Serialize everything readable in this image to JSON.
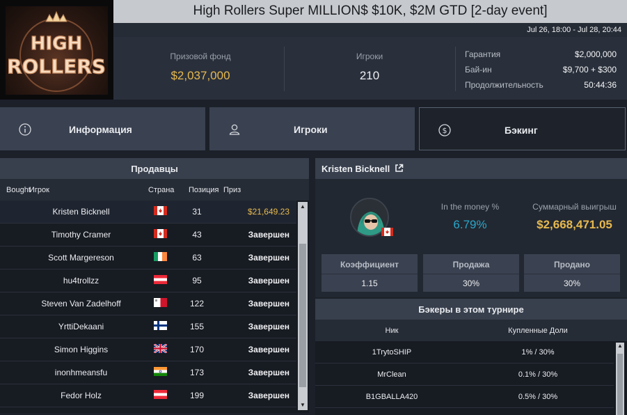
{
  "header": {
    "logo_text": "HIGH ROLLERS",
    "title": "High Rollers Super MILLION$ $10K, $2M GTD [2-day event]",
    "dates": "Jul 26, 18:00 - Jul 28, 20:44"
  },
  "stats": {
    "prize_pool_label": "Призовой фонд",
    "prize_pool_value": "$2,037,000",
    "players_label": "Игроки",
    "players_value": "210",
    "details": [
      {
        "label": "Гарантия",
        "value": "$2,000,000"
      },
      {
        "label": "Бай-ин",
        "value": "$9,700 + $300"
      },
      {
        "label": "Продолжительность",
        "value": "50:44:36"
      }
    ]
  },
  "tabs": [
    {
      "label": "Информация",
      "icon": "info-circle-icon",
      "active": false
    },
    {
      "label": "Игроки",
      "icon": "user-icon",
      "active": false
    },
    {
      "label": "Бэкинг",
      "icon": "dollar-circle-icon",
      "active": true
    }
  ],
  "sellers": {
    "title": "Продавцы",
    "columns": {
      "bought": "Bought",
      "player": "Игрок",
      "country": "Страна",
      "position": "Позиция",
      "prize": "Приз"
    },
    "rows": [
      {
        "name": "Kristen Bicknell",
        "flag": "ca",
        "position": "31",
        "prize": "$21,649.23",
        "gold": true
      },
      {
        "name": "Timothy Cramer",
        "flag": "ca",
        "position": "43",
        "prize": "Завершен",
        "gold": false
      },
      {
        "name": "Scott Margereson",
        "flag": "ie",
        "position": "63",
        "prize": "Завершен",
        "gold": false
      },
      {
        "name": "hu4trollzz",
        "flag": "at",
        "position": "95",
        "prize": "Завершен",
        "gold": false
      },
      {
        "name": "Steven Van Zadelhoff",
        "flag": "mt",
        "position": "122",
        "prize": "Завершен",
        "gold": false
      },
      {
        "name": "YrttiDekaani",
        "flag": "fi",
        "position": "155",
        "prize": "Завершен",
        "gold": false
      },
      {
        "name": "Simon Higgins",
        "flag": "gb",
        "position": "170",
        "prize": "Завершен",
        "gold": false
      },
      {
        "name": "inonhmeansfu",
        "flag": "in",
        "position": "173",
        "prize": "Завершен",
        "gold": false
      },
      {
        "name": "Fedor Holz",
        "flag": "at",
        "position": "199",
        "prize": "Завершен",
        "gold": false
      }
    ]
  },
  "player": {
    "name": "Kristen Bicknell",
    "itm_label": "In the money %",
    "itm_value": "6.79%",
    "winnings_label": "Суммарный выигрыш",
    "winnings_value": "$2,668,471.05",
    "boxes": [
      {
        "label": "Коэффициент",
        "value": "1.15"
      },
      {
        "label": "Продажа",
        "value": "30%"
      },
      {
        "label": "Продано",
        "value": "30%"
      }
    ],
    "flag": "ca"
  },
  "backers": {
    "title": "Бэкеры в этом турнире",
    "columns": {
      "nick": "Ник",
      "shares": "Купленные Доли"
    },
    "rows": [
      {
        "nick": "1TrytoSHIP",
        "shares": "1% / 30%"
      },
      {
        "nick": "MrClean",
        "shares": "0.1% / 30%"
      },
      {
        "nick": "B1GBALLA420",
        "shares": "0.5% / 30%"
      }
    ]
  },
  "colors": {
    "gold": "#e7b94f",
    "teal": "#2aa6c9",
    "accent_bg": "#3a4150"
  }
}
